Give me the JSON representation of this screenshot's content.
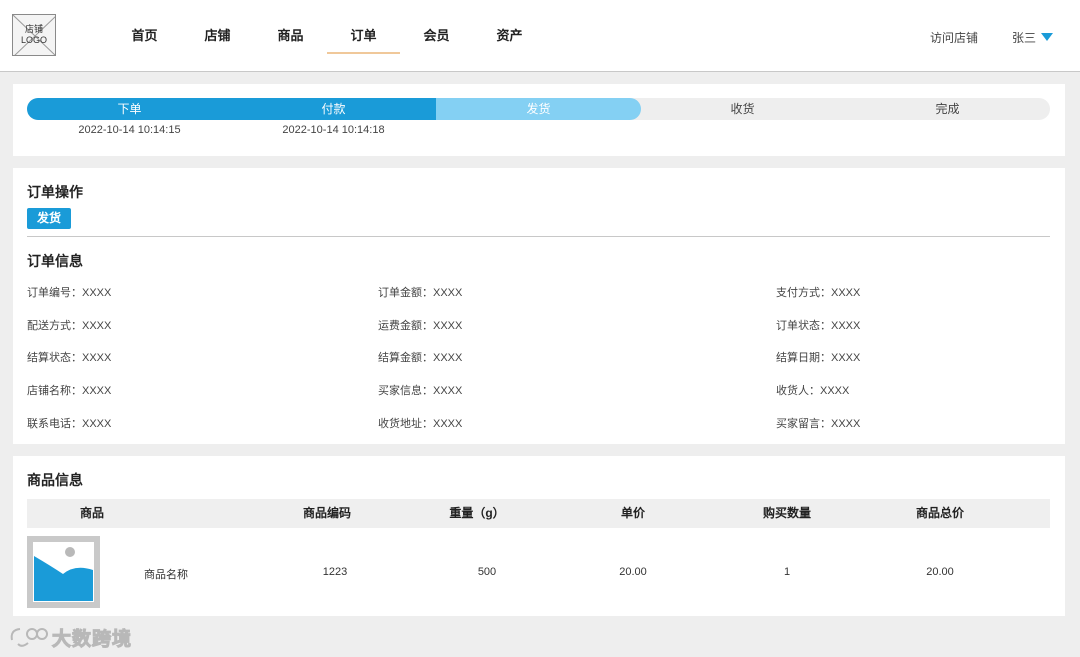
{
  "header": {
    "logo_text": "店铺\nLOGO",
    "nav": [
      "首页",
      "店铺",
      "商品",
      "订单",
      "会员",
      "资产"
    ],
    "active_nav": "订单",
    "visit_store": "访问店铺",
    "user_name": "张三"
  },
  "steps": {
    "items": [
      "下单",
      "付款",
      "发货",
      "收货",
      "完成"
    ],
    "times": [
      "2022-10-14 10:14:15",
      "2022-10-14 10:14:18"
    ],
    "current": "发货"
  },
  "order_ops": {
    "title": "订单操作",
    "ship_button": "发货"
  },
  "order_info": {
    "title": "订单信息",
    "fields": [
      [
        "订单编号：XXXX",
        "订单金额：XXXX",
        "支付方式：XXXX"
      ],
      [
        "配送方式：XXXX",
        "运费金额：XXXX",
        "订单状态：XXXX"
      ],
      [
        "结算状态：XXXX",
        "结算金额：XXXX",
        "结算日期：XXXX"
      ],
      [
        "店铺名称：XXXX",
        "买家信息：XXXX",
        "收货人：XXXX"
      ],
      [
        "联系电话：XXXX",
        "收货地址：XXXX",
        "买家留言：XXXX"
      ]
    ]
  },
  "goods": {
    "title": "商品信息",
    "columns": [
      "商品",
      "商品编码",
      "重量（g）",
      "单价",
      "购买数量",
      "商品总价"
    ],
    "rows": [
      {
        "name": "商品名称",
        "code": "1223",
        "weight": "500",
        "price": "20.00",
        "qty": "1",
        "total": "20.00"
      }
    ]
  },
  "watermark": {
    "text": "大数跨境"
  },
  "colors": {
    "accent": "#1a9bd8",
    "accent_light": "#84d0f3",
    "nav_underline": "#f0c89a"
  }
}
